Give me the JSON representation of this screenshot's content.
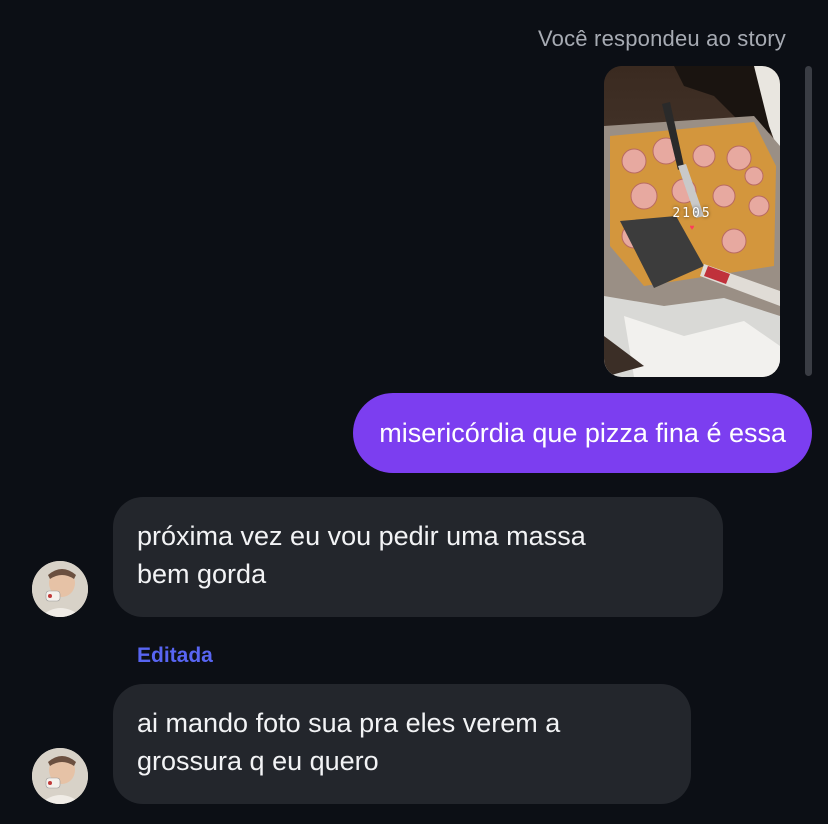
{
  "thread": {
    "reply_caption": "Você respondeu ao story",
    "story_thumbnail": {
      "overlay_count": "2105",
      "overlay_heart": "♥"
    }
  },
  "messages": [
    {
      "direction": "sent",
      "text": "misericórdia que pizza fina é essa"
    },
    {
      "direction": "received",
      "lines": [
        "próxima vez eu vou pedir uma massa",
        "bem gorda"
      ]
    },
    {
      "direction": "received",
      "edited_label": "Editada",
      "lines": [
        "ai mando foto sua pra eles verem a",
        "grossura q eu quero"
      ]
    }
  ],
  "colors": {
    "background": "#0c0f15",
    "sent_bubble": "#7c3ef0",
    "received_bubble": "#23262c",
    "edited_label": "#5865f2",
    "caption": "#a7abb3"
  },
  "icons": {
    "avatar": "contact-avatar-photo",
    "story": "story-photo-pizza"
  }
}
